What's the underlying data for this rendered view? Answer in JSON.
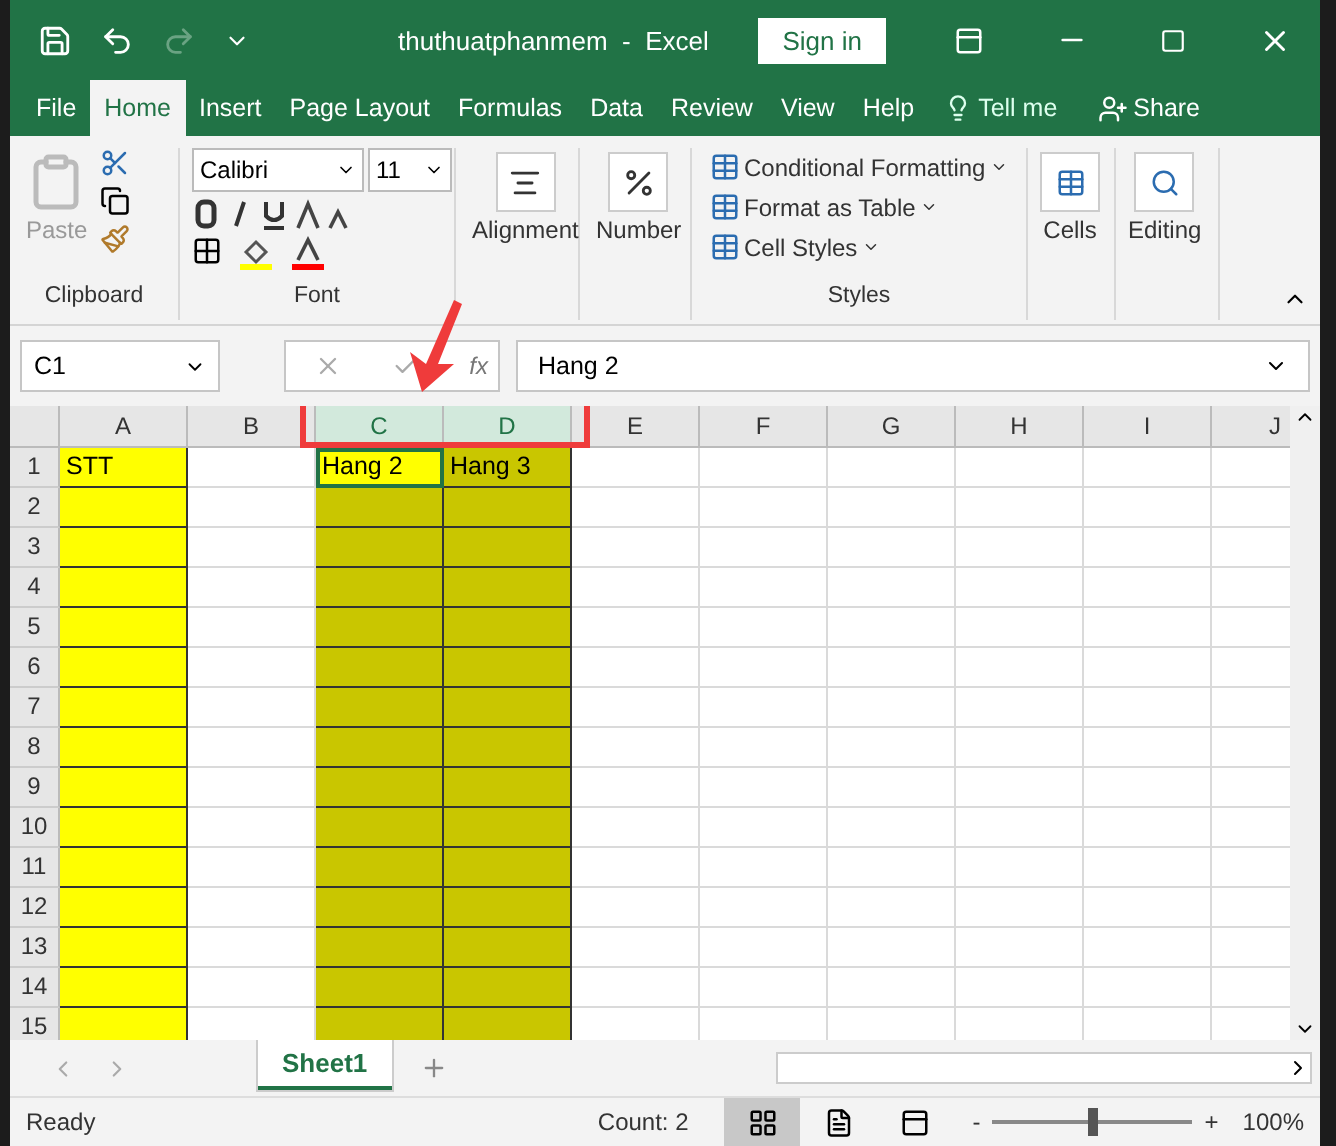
{
  "window": {
    "title": "thuthuatphanmem  -  Excel",
    "sign_in": "Sign in"
  },
  "tabs": [
    {
      "label": "File",
      "selected": false
    },
    {
      "label": "Home",
      "selected": true
    },
    {
      "label": "Insert",
      "selected": false
    },
    {
      "label": "Page Layout",
      "selected": false
    },
    {
      "label": "Formulas",
      "selected": false
    },
    {
      "label": "Data",
      "selected": false
    },
    {
      "label": "Review",
      "selected": false
    },
    {
      "label": "View",
      "selected": false
    },
    {
      "label": "Help",
      "selected": false
    }
  ],
  "tell_me": "Tell me",
  "share": "Share",
  "ribbon": {
    "paste": "Paste",
    "font_name": "Calibri",
    "font_size": "11",
    "groups": [
      "Clipboard",
      "Font",
      "Alignment",
      "Number",
      "Styles",
      "Cells",
      "Editing"
    ],
    "styles": [
      "Conditional Formatting",
      "Format as Table",
      "Cell Styles"
    ]
  },
  "formula_bar": {
    "name_box": "C1",
    "fx": "fx",
    "value": "Hang 2"
  },
  "grid": {
    "columns": [
      {
        "label": "A",
        "selected": false,
        "filled": true,
        "active": false
      },
      {
        "label": "B",
        "selected": false,
        "filled": false,
        "active": false
      },
      {
        "label": "C",
        "selected": true,
        "filled": true,
        "active": true
      },
      {
        "label": "D",
        "selected": true,
        "filled": true,
        "active": false
      },
      {
        "label": "E",
        "selected": false,
        "filled": false,
        "active": false
      },
      {
        "label": "F",
        "selected": false,
        "filled": false,
        "active": false
      },
      {
        "label": "G",
        "selected": false,
        "filled": false,
        "active": false
      },
      {
        "label": "H",
        "selected": false,
        "filled": false,
        "active": false
      },
      {
        "label": "I",
        "selected": false,
        "filled": false,
        "active": false
      },
      {
        "label": "J",
        "selected": false,
        "filled": false,
        "active": false
      }
    ],
    "rows": [
      {
        "label": "1",
        "active": true,
        "cells": [
          "STT",
          "",
          "Hang 2",
          "Hang 3"
        ]
      },
      {
        "label": "2",
        "cells": []
      },
      {
        "label": "3",
        "cells": []
      },
      {
        "label": "4",
        "cells": []
      },
      {
        "label": "5",
        "cells": []
      },
      {
        "label": "6",
        "cells": []
      },
      {
        "label": "7",
        "cells": []
      },
      {
        "label": "8",
        "cells": []
      },
      {
        "label": "9",
        "cells": []
      },
      {
        "label": "10",
        "cells": []
      },
      {
        "label": "11",
        "cells": []
      },
      {
        "label": "12",
        "cells": []
      },
      {
        "label": "13",
        "cells": []
      },
      {
        "label": "14",
        "cells": []
      },
      {
        "label": "15",
        "cells": []
      }
    ]
  },
  "sheets": [
    {
      "label": "Sheet1",
      "selected": true
    }
  ],
  "status": {
    "ready": "Ready",
    "count": "Count: 2",
    "views": [
      {
        "kind": "normal",
        "selected": true
      },
      {
        "kind": "page",
        "selected": false
      },
      {
        "kind": "break",
        "selected": false
      }
    ],
    "zoom_minus": "-",
    "zoom_plus": "+",
    "zoom": {
      "level": 0.5
    },
    "zoom_text": "100%"
  }
}
